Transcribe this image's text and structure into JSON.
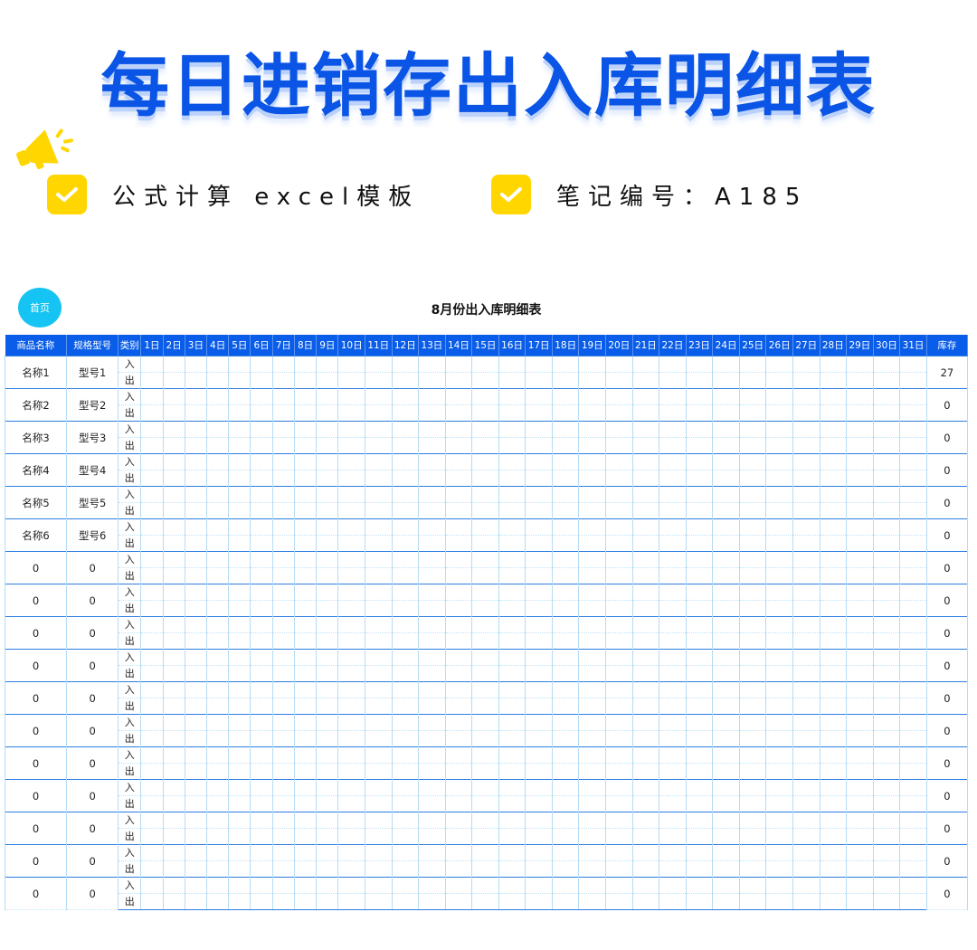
{
  "banner": {
    "title": "每日进销存出入库明细表",
    "feature_1": "公式计算 excel模板",
    "feature_2": "笔记编号：A185"
  },
  "sheet": {
    "home_button": "首页",
    "title": "8月份出入库明细表",
    "headers": {
      "name": "商品名称",
      "model": "规格型号",
      "kind": "类别",
      "days": [
        "1日",
        "2日",
        "3日",
        "4日",
        "5日",
        "6日",
        "7日",
        "8日",
        "9日",
        "10日",
        "11日",
        "12日",
        "13日",
        "14日",
        "15日",
        "16日",
        "17日",
        "18日",
        "19日",
        "20日",
        "21日",
        "22日",
        "23日",
        "24日",
        "25日",
        "26日",
        "27日",
        "28日",
        "29日",
        "30日",
        "31日"
      ],
      "stock": "库存"
    },
    "kind_in": "入",
    "kind_out": "出",
    "rows": [
      {
        "name": "名称1",
        "model": "型号1",
        "stock": "27"
      },
      {
        "name": "名称2",
        "model": "型号2",
        "stock": "0"
      },
      {
        "name": "名称3",
        "model": "型号3",
        "stock": "0"
      },
      {
        "name": "名称4",
        "model": "型号4",
        "stock": "0"
      },
      {
        "name": "名称5",
        "model": "型号5",
        "stock": "0"
      },
      {
        "name": "名称6",
        "model": "型号6",
        "stock": "0"
      },
      {
        "name": "0",
        "model": "0",
        "stock": "0"
      },
      {
        "name": "0",
        "model": "0",
        "stock": "0"
      },
      {
        "name": "0",
        "model": "0",
        "stock": "0"
      },
      {
        "name": "0",
        "model": "0",
        "stock": "0"
      },
      {
        "name": "0",
        "model": "0",
        "stock": "0"
      },
      {
        "name": "0",
        "model": "0",
        "stock": "0"
      },
      {
        "name": "0",
        "model": "0",
        "stock": "0"
      },
      {
        "name": "0",
        "model": "0",
        "stock": "0"
      },
      {
        "name": "0",
        "model": "0",
        "stock": "0"
      },
      {
        "name": "0",
        "model": "0",
        "stock": "0"
      },
      {
        "name": "0",
        "model": "0",
        "stock": "0"
      }
    ]
  },
  "colors": {
    "title_blue": "#0a54e6",
    "header_blue": "#0a5de8",
    "check_yellow": "#ffd600",
    "home_cyan": "#15c4f2"
  },
  "icons": [
    "megaphone-icon",
    "check-icon"
  ]
}
